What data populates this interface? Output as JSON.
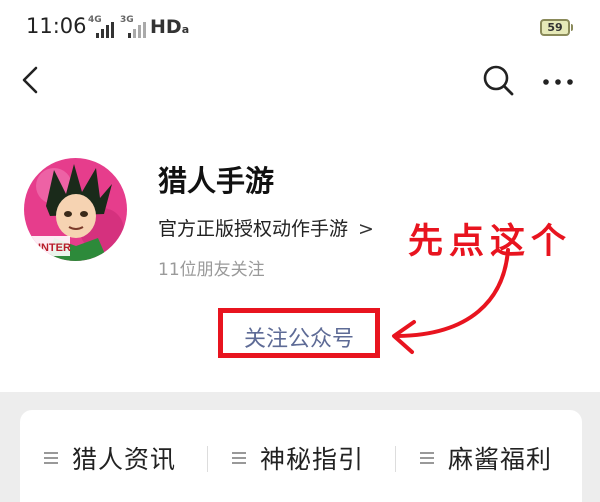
{
  "status": {
    "time": "11:06",
    "sim1_tag": "4G",
    "sim2_tag": "3G",
    "hd": "HD",
    "battery": "59"
  },
  "nav": {
    "back_icon": "chevron-left-icon",
    "search_icon": "search-icon",
    "more_icon": "more-dots-icon"
  },
  "account": {
    "name": "猎人手游",
    "description": "官方正版授权动作手游",
    "chevron": ">",
    "friends_following": "11位朋友关注",
    "follow_button": "关注公众号",
    "avatar_caption": "HUNTER"
  },
  "annotation": {
    "text": "先点这个",
    "color": "#e8141f"
  },
  "menu": {
    "items": [
      {
        "label": "猎人资讯"
      },
      {
        "label": "神秘指引"
      },
      {
        "label": "麻酱福利"
      }
    ]
  },
  "colors": {
    "accent_link": "#5e6b96",
    "annotation_red": "#e8141f",
    "gray_bg": "#ededed"
  }
}
